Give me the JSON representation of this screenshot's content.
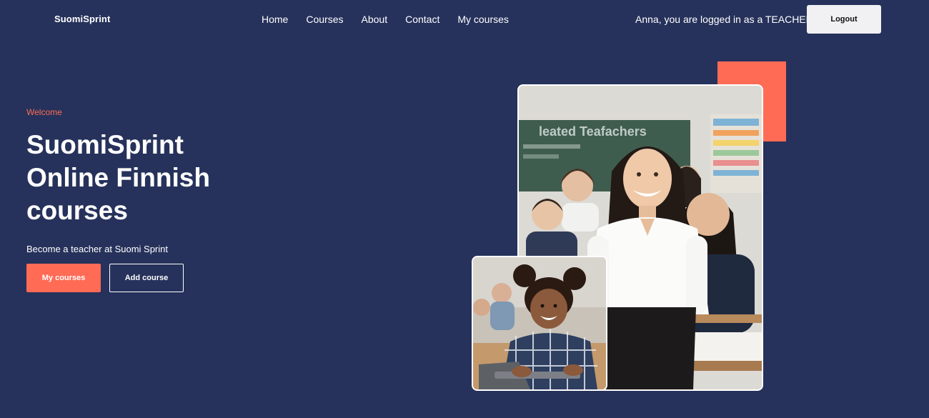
{
  "header": {
    "brand": "SuomiSprint",
    "nav": [
      "Home",
      "Courses",
      "About",
      "Contact",
      "My courses"
    ],
    "user_status": "Anna, you are logged in as a TEACHER",
    "logout_label": "Logout"
  },
  "hero": {
    "eyebrow": "Welcome",
    "title": "SuomiSprint\nOnline Finnish\ncourses",
    "subtitle": "Become a teacher at Suomi Sprint",
    "primary_button": "My courses",
    "secondary_button": "Add course"
  },
  "colors": {
    "background": "#26325b",
    "accent": "#ff6b55",
    "logout_bg": "#f1f1f3"
  },
  "images": {
    "main_photo": "teacher-classroom-photo",
    "small_photo": "student-laptop-photo"
  }
}
